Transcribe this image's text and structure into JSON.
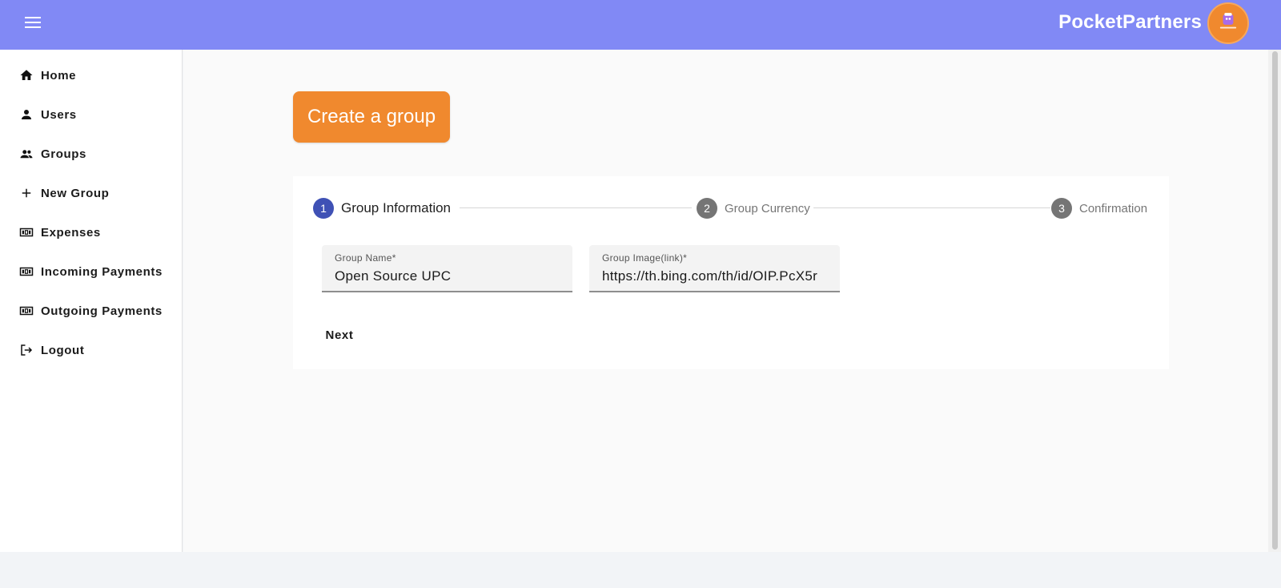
{
  "header": {
    "brand": "PocketPartners",
    "menu_icon": "menu-icon",
    "avatar_icon": "pocket-logo-icon",
    "colors": {
      "bar": "#8189f5",
      "avatar": "#f0892e"
    }
  },
  "sidebar": {
    "items": [
      {
        "label": "Home",
        "icon": "home-icon"
      },
      {
        "label": "Users",
        "icon": "person-icon"
      },
      {
        "label": "Groups",
        "icon": "people-icon"
      },
      {
        "label": "New Group",
        "icon": "plus-icon"
      },
      {
        "label": "Expenses",
        "icon": "money-icon"
      },
      {
        "label": "Incoming Payments",
        "icon": "money-icon"
      },
      {
        "label": "Outgoing Payments",
        "icon": "money-icon"
      },
      {
        "label": "Logout",
        "icon": "logout-icon"
      }
    ]
  },
  "main": {
    "create_label": "Create a group",
    "stepper": {
      "steps": [
        {
          "number": "1",
          "label": "Group Information",
          "state": "active"
        },
        {
          "number": "2",
          "label": "Group Currency",
          "state": "inactive"
        },
        {
          "number": "3",
          "label": "Confirmation",
          "state": "inactive"
        }
      ]
    },
    "form": {
      "group_name": {
        "label": "Group Name*",
        "value": "Open Source UPC"
      },
      "group_image": {
        "label": "Group Image(link)*",
        "value": "https://th.bing.com/th/id/OIP.PcX5r"
      }
    },
    "next_label": "Next"
  }
}
